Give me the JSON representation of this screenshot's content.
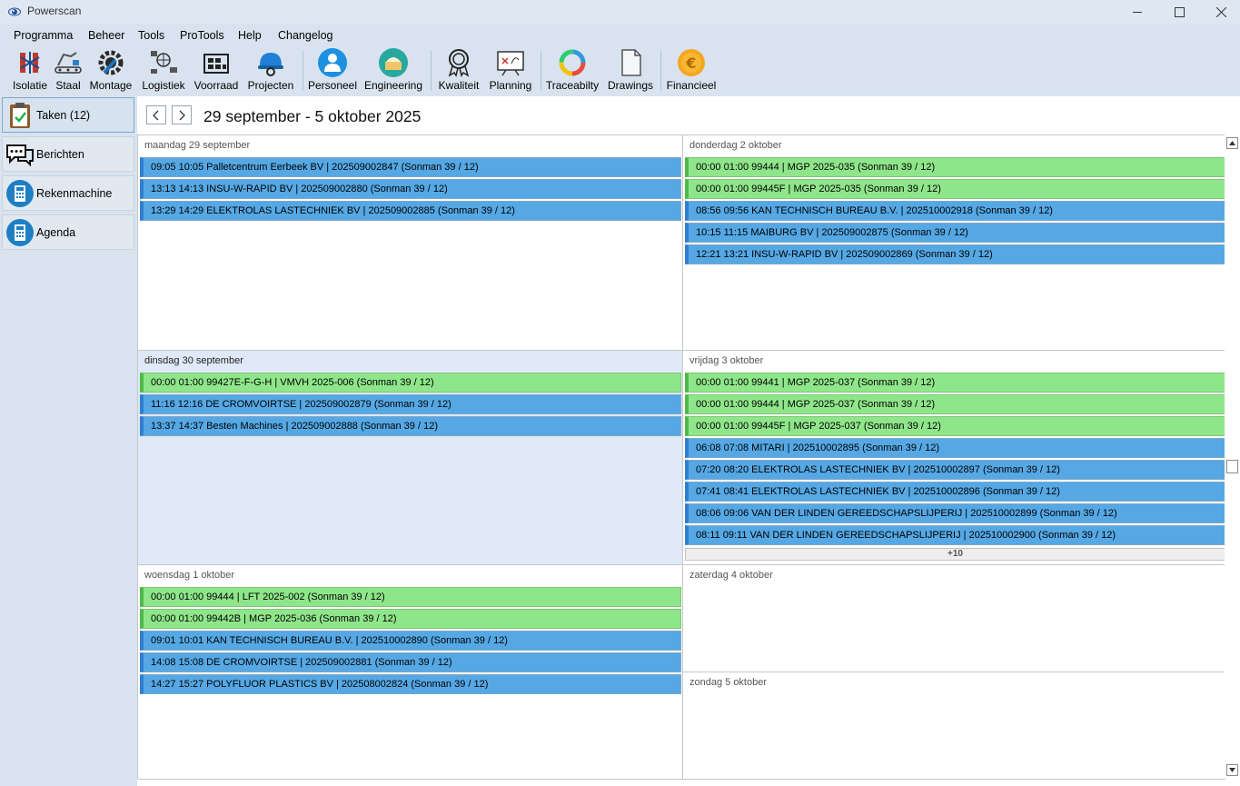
{
  "window": {
    "title": "Powerscan"
  },
  "menu": [
    "Programma",
    "Beheer",
    "Tools",
    "ProTools",
    "Help",
    "Changelog"
  ],
  "toolbar": [
    {
      "label": "Isolatie",
      "icon": "snowflake-icon"
    },
    {
      "label": "Staal",
      "icon": "conveyor-icon"
    },
    {
      "label": "Montage",
      "icon": "wrench-gear-icon"
    },
    {
      "label": "Logistiek",
      "icon": "logistics-icon"
    },
    {
      "label": "Voorraad",
      "icon": "warehouse-icon"
    },
    {
      "label": "Projecten",
      "icon": "hardhat-icon"
    },
    {
      "label": "Personeel",
      "icon": "person-icon"
    },
    {
      "label": "Engineering",
      "icon": "engineering-icon"
    },
    {
      "label": "Kwaliteit",
      "icon": "award-icon"
    },
    {
      "label": "Planning",
      "icon": "planning-board-icon"
    },
    {
      "label": "Traceabilty",
      "icon": "cycle-icon"
    },
    {
      "label": "Drawings",
      "icon": "document-icon"
    },
    {
      "label": "Financieel",
      "icon": "euro-coin-icon"
    }
  ],
  "nav": [
    {
      "label": "Taken (12)",
      "icon": "clipboard-check-icon",
      "active": true
    },
    {
      "label": "Berichten",
      "icon": "chat-bubbles-icon",
      "active": false
    },
    {
      "label": "Rekenmachine",
      "icon": "calculator-icon",
      "active": false
    },
    {
      "label": "Agenda",
      "icon": "calculator-icon",
      "active": false
    }
  ],
  "week": {
    "title": "29 september - 5 oktober 2025",
    "prev": "<",
    "next": ">"
  },
  "days": {
    "mon": {
      "label": "maandag 29 september",
      "events": [
        {
          "text": "09:05  10:05  Palletcentrum Eerbeek BV | 202509002847 (Sonman 39 / 12)",
          "color": "blue"
        },
        {
          "text": "13:13  14:13  INSU-W-RAPID  BV | 202509002880 (Sonman 39 / 12)",
          "color": "blue"
        },
        {
          "text": "13:29  14:29  ELEKTROLAS LASTECHNIEK BV | 202509002885 (Sonman 39 / 12)",
          "color": "blue"
        }
      ]
    },
    "tue": {
      "label": "dinsdag 30 september",
      "events": [
        {
          "text": "00:00  01:00  99427E-F-G-H | VMVH 2025-006 (Sonman 39 / 12)",
          "color": "green"
        },
        {
          "text": "11:16  12:16  DE CROMVOIRTSE | 202509002879 (Sonman 39 / 12)",
          "color": "blue"
        },
        {
          "text": "13:37  14:37  Besten Machines  | 202509002888 (Sonman 39 / 12)",
          "color": "blue"
        }
      ]
    },
    "wed": {
      "label": "woensdag 1 oktober",
      "events": [
        {
          "text": "00:00  01:00  99444 | LFT 2025-002 (Sonman 39 / 12)",
          "color": "green"
        },
        {
          "text": "00:00  01:00  99442B | MGP 2025-036 (Sonman 39 / 12)",
          "color": "green"
        },
        {
          "text": "09:01  10:01  KAN TECHNISCH BUREAU B.V. | 202510002890 (Sonman 39 / 12)",
          "color": "blue"
        },
        {
          "text": "14:08  15:08  DE CROMVOIRTSE | 202509002881 (Sonman 39 / 12)",
          "color": "blue"
        },
        {
          "text": "14:27  15:27  POLYFLUOR PLASTICS BV | 202508002824 (Sonman 39 / 12)",
          "color": "blue"
        }
      ]
    },
    "thu": {
      "label": "donderdag 2 oktober",
      "events": [
        {
          "text": "00:00  01:00  99444 | MGP 2025-035 (Sonman 39 / 12)",
          "color": "green"
        },
        {
          "text": "00:00  01:00  99445F | MGP 2025-035 (Sonman 39 / 12)",
          "color": "green"
        },
        {
          "text": "08:56  09:56  KAN TECHNISCH BUREAU B.V. | 202510002918 (Sonman 39 / 12)",
          "color": "blue"
        },
        {
          "text": "10:15  11:15  MAIBURG BV | 202509002875 (Sonman 39 / 12)",
          "color": "blue"
        },
        {
          "text": "12:21  13:21  INSU-W-RAPID  BV | 202509002869 (Sonman 39 / 12)",
          "color": "blue"
        }
      ]
    },
    "fri": {
      "label": "vrijdag 3 oktober",
      "events": [
        {
          "text": "00:00  01:00  99441 | MGP 2025-037 (Sonman 39 / 12)",
          "color": "green"
        },
        {
          "text": "00:00  01:00  99444 | MGP 2025-037 (Sonman 39 / 12)",
          "color": "green"
        },
        {
          "text": "00:00  01:00  99445F | MGP 2025-037 (Sonman 39 / 12)",
          "color": "green"
        },
        {
          "text": "06:08  07:08  MITARI | 202510002895 (Sonman 39 / 12)",
          "color": "blue"
        },
        {
          "text": "07:20  08:20  ELEKTROLAS LASTECHNIEK BV | 202510002897 (Sonman 39 / 12)",
          "color": "blue"
        },
        {
          "text": "07:41  08:41  ELEKTROLAS LASTECHNIEK BV | 202510002896 (Sonman 39 / 12)",
          "color": "blue"
        },
        {
          "text": "08:06  09:06  VAN DER LINDEN GEREEDSCHAPSLIJPERIJ | 202510002899 (Sonman 39 / 12)",
          "color": "blue"
        },
        {
          "text": "08:11  09:11  VAN DER LINDEN GEREEDSCHAPSLIJPERIJ | 202510002900 (Sonman 39 / 12)",
          "color": "blue"
        }
      ],
      "more": "+10"
    },
    "sat": {
      "label": "zaterdag 4 oktober",
      "events": []
    },
    "sun": {
      "label": "zondag 5 oktober",
      "events": []
    }
  },
  "colors": {
    "event_blue": "#55a8e4",
    "event_green": "#8fe68a",
    "selected_day": "#dfe9f8"
  }
}
